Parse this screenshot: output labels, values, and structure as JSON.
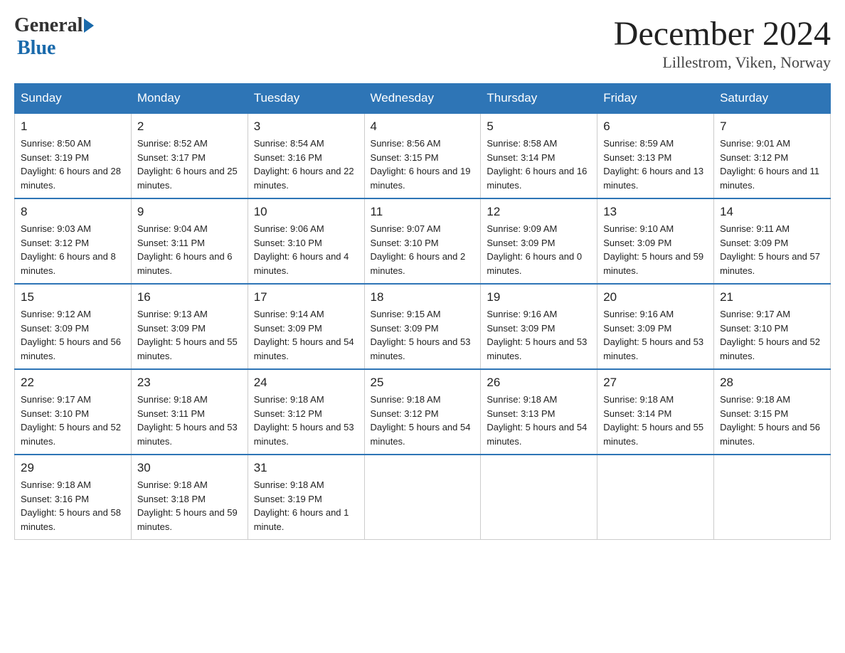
{
  "header": {
    "logo_general": "General",
    "logo_blue": "Blue",
    "month": "December 2024",
    "location": "Lillestrom, Viken, Norway"
  },
  "weekdays": [
    "Sunday",
    "Monday",
    "Tuesday",
    "Wednesday",
    "Thursday",
    "Friday",
    "Saturday"
  ],
  "weeks": [
    [
      {
        "day": "1",
        "sunrise": "8:50 AM",
        "sunset": "3:19 PM",
        "daylight": "6 hours and 28 minutes."
      },
      {
        "day": "2",
        "sunrise": "8:52 AM",
        "sunset": "3:17 PM",
        "daylight": "6 hours and 25 minutes."
      },
      {
        "day": "3",
        "sunrise": "8:54 AM",
        "sunset": "3:16 PM",
        "daylight": "6 hours and 22 minutes."
      },
      {
        "day": "4",
        "sunrise": "8:56 AM",
        "sunset": "3:15 PM",
        "daylight": "6 hours and 19 minutes."
      },
      {
        "day": "5",
        "sunrise": "8:58 AM",
        "sunset": "3:14 PM",
        "daylight": "6 hours and 16 minutes."
      },
      {
        "day": "6",
        "sunrise": "8:59 AM",
        "sunset": "3:13 PM",
        "daylight": "6 hours and 13 minutes."
      },
      {
        "day": "7",
        "sunrise": "9:01 AM",
        "sunset": "3:12 PM",
        "daylight": "6 hours and 11 minutes."
      }
    ],
    [
      {
        "day": "8",
        "sunrise": "9:03 AM",
        "sunset": "3:12 PM",
        "daylight": "6 hours and 8 minutes."
      },
      {
        "day": "9",
        "sunrise": "9:04 AM",
        "sunset": "3:11 PM",
        "daylight": "6 hours and 6 minutes."
      },
      {
        "day": "10",
        "sunrise": "9:06 AM",
        "sunset": "3:10 PM",
        "daylight": "6 hours and 4 minutes."
      },
      {
        "day": "11",
        "sunrise": "9:07 AM",
        "sunset": "3:10 PM",
        "daylight": "6 hours and 2 minutes."
      },
      {
        "day": "12",
        "sunrise": "9:09 AM",
        "sunset": "3:09 PM",
        "daylight": "6 hours and 0 minutes."
      },
      {
        "day": "13",
        "sunrise": "9:10 AM",
        "sunset": "3:09 PM",
        "daylight": "5 hours and 59 minutes."
      },
      {
        "day": "14",
        "sunrise": "9:11 AM",
        "sunset": "3:09 PM",
        "daylight": "5 hours and 57 minutes."
      }
    ],
    [
      {
        "day": "15",
        "sunrise": "9:12 AM",
        "sunset": "3:09 PM",
        "daylight": "5 hours and 56 minutes."
      },
      {
        "day": "16",
        "sunrise": "9:13 AM",
        "sunset": "3:09 PM",
        "daylight": "5 hours and 55 minutes."
      },
      {
        "day": "17",
        "sunrise": "9:14 AM",
        "sunset": "3:09 PM",
        "daylight": "5 hours and 54 minutes."
      },
      {
        "day": "18",
        "sunrise": "9:15 AM",
        "sunset": "3:09 PM",
        "daylight": "5 hours and 53 minutes."
      },
      {
        "day": "19",
        "sunrise": "9:16 AM",
        "sunset": "3:09 PM",
        "daylight": "5 hours and 53 minutes."
      },
      {
        "day": "20",
        "sunrise": "9:16 AM",
        "sunset": "3:09 PM",
        "daylight": "5 hours and 53 minutes."
      },
      {
        "day": "21",
        "sunrise": "9:17 AM",
        "sunset": "3:10 PM",
        "daylight": "5 hours and 52 minutes."
      }
    ],
    [
      {
        "day": "22",
        "sunrise": "9:17 AM",
        "sunset": "3:10 PM",
        "daylight": "5 hours and 52 minutes."
      },
      {
        "day": "23",
        "sunrise": "9:18 AM",
        "sunset": "3:11 PM",
        "daylight": "5 hours and 53 minutes."
      },
      {
        "day": "24",
        "sunrise": "9:18 AM",
        "sunset": "3:12 PM",
        "daylight": "5 hours and 53 minutes."
      },
      {
        "day": "25",
        "sunrise": "9:18 AM",
        "sunset": "3:12 PM",
        "daylight": "5 hours and 54 minutes."
      },
      {
        "day": "26",
        "sunrise": "9:18 AM",
        "sunset": "3:13 PM",
        "daylight": "5 hours and 54 minutes."
      },
      {
        "day": "27",
        "sunrise": "9:18 AM",
        "sunset": "3:14 PM",
        "daylight": "5 hours and 55 minutes."
      },
      {
        "day": "28",
        "sunrise": "9:18 AM",
        "sunset": "3:15 PM",
        "daylight": "5 hours and 56 minutes."
      }
    ],
    [
      {
        "day": "29",
        "sunrise": "9:18 AM",
        "sunset": "3:16 PM",
        "daylight": "5 hours and 58 minutes."
      },
      {
        "day": "30",
        "sunrise": "9:18 AM",
        "sunset": "3:18 PM",
        "daylight": "5 hours and 59 minutes."
      },
      {
        "day": "31",
        "sunrise": "9:18 AM",
        "sunset": "3:19 PM",
        "daylight": "6 hours and 1 minute."
      },
      null,
      null,
      null,
      null
    ]
  ],
  "labels": {
    "sunrise": "Sunrise:",
    "sunset": "Sunset:",
    "daylight": "Daylight:"
  }
}
